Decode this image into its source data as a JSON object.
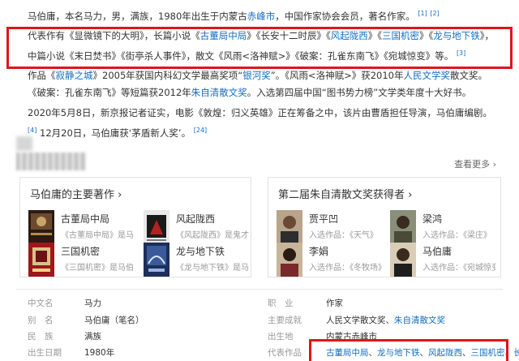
{
  "intro": {
    "p1": "马伯庸，本名马力，男，满族，1980年出生于内蒙古",
    "p1_link": "赤峰市",
    "p1_rest": "，中国作家协会会员，著名作家。",
    "p1_refs": [
      "[1]",
      "[2]"
    ]
  },
  "works_para": {
    "lead1": "代表作有《显微镜下的大明》，长篇小说《",
    "l1": "古董局中局",
    "s1": "》《长安十二时辰》《",
    "l2": "风起陇西",
    "s2": "》《",
    "l3": "三国机密",
    "s3": "》《",
    "l4": "龙与地下铁",
    "s4": "》，中篇小说《末日焚书》《街亭杀人事件》，散文《风雨<洛神赋>》《破案：孔雀东南飞》《宛城惊变》等。",
    "ref": "[3]"
  },
  "awards_para": {
    "t1": "作品《",
    "l1": "寂静之城",
    "t2": "》2005年获国内科幻文学最高奖项“",
    "l2": "银河奖",
    "t3": "”。《风雨<洛神赋>》获2010年",
    "l3": "人民文学奖",
    "t4": "散文奖。《破案：孔雀东南飞》等短篇获2012年",
    "l4": "朱自清散文奖",
    "t5": "。入选第四届中国“图书势力榜”文学类年度十大好书。"
  },
  "news_para": {
    "t1": "2020年5月8日，新京报记者证实，电影《敦煌：归义英雄》正在筹备之中，该片由曹盾担任导演，马伯庸编剧。",
    "ref1": "[4]",
    "t2": "12月20日，马伯庸获‘茅盾新人奖’。",
    "ref2": "[24]"
  },
  "section": {
    "more": "查看更多 ›"
  },
  "left_card": {
    "title": "马伯庸的主要著作 ›",
    "items": [
      {
        "name": "古董局中局",
        "sub": "《古董局中局》是马",
        "icon": "book-cover-icon"
      },
      {
        "name": "风起陇西",
        "sub": "《风起陇西》是鬼才",
        "icon": "book-cover-icon"
      },
      {
        "name": "三国机密",
        "sub": "《三国机密》是马伯",
        "icon": "book-cover-icon"
      },
      {
        "name": "龙与地下铁",
        "sub": "《龙与地下铁》是马",
        "icon": "book-cover-icon"
      }
    ]
  },
  "right_card": {
    "title": "第二届朱自清散文奖获得者 ›",
    "items": [
      {
        "name": "贾平凹",
        "sub": "入选作品：《天气》",
        "icon": "portrait-icon"
      },
      {
        "name": "梁鸿",
        "sub": "入选作品：《梁庄》",
        "icon": "portrait-icon"
      },
      {
        "name": "李娟",
        "sub": "入选作品：《冬牧场》",
        "icon": "portrait-icon"
      },
      {
        "name": "马伯庸",
        "sub": "入选作品：《宛城惊变》",
        "icon": "portrait-icon"
      }
    ]
  },
  "basic_info": {
    "left": [
      {
        "label": "中文名",
        "value": "马力"
      },
      {
        "label": "别　名",
        "value": "马伯庸（笔名）"
      },
      {
        "label": "民　族",
        "value": "满族"
      },
      {
        "label": "出生日期",
        "value": "1980年"
      }
    ],
    "right": [
      {
        "label": "职　业",
        "value": "作家"
      },
      {
        "label": "主要成就",
        "value": "人民文学散文奖、",
        "link": "朱自清散文奖"
      },
      {
        "label": "出生地",
        "value": "内蒙古赤峰市"
      },
      {
        "label": "代表作品",
        "links": [
          "古董局中局",
          "龙与地下铁",
          "风起陇西",
          "三国机密",
          "长"
        ]
      }
    ]
  },
  "colors": {
    "link": "#136ec2",
    "highlight_box": "#e0151b"
  }
}
